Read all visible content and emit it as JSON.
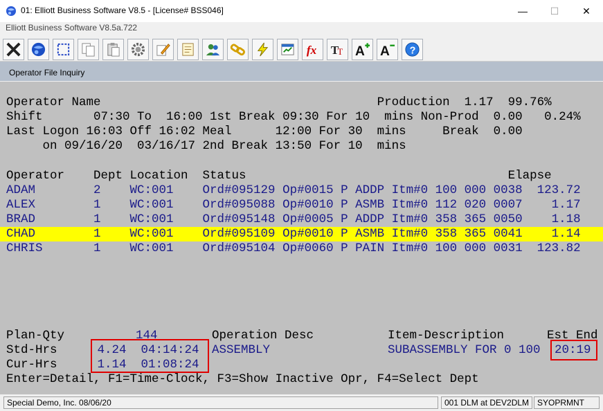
{
  "window": {
    "title": "01: Elliott Business Software V8.5 - [License# BSS046]",
    "subtitle": "Elliott Business Software V8.5a.722",
    "controls": {
      "minimize": "—",
      "maximize": "☐",
      "close": "✕"
    }
  },
  "toolbar": {
    "buttons": [
      {
        "icon": "close-x-icon"
      },
      {
        "icon": "globe-icon"
      },
      {
        "icon": "select-box-icon"
      },
      {
        "icon": "copy-icon"
      },
      {
        "icon": "paste-icon"
      },
      {
        "icon": "gear-icon"
      },
      {
        "icon": "edit-pencil-icon"
      },
      {
        "icon": "notepad-icon"
      },
      {
        "icon": "users-icon"
      },
      {
        "icon": "chain-link-icon"
      },
      {
        "icon": "lightning-icon"
      },
      {
        "icon": "report-icon"
      },
      {
        "icon": "function-fx-icon"
      },
      {
        "icon": "font-tt-icon"
      },
      {
        "icon": "font-increase-icon"
      },
      {
        "icon": "font-decrease-icon"
      },
      {
        "icon": "help-icon"
      }
    ]
  },
  "panel": {
    "title": "Operator File Inquiry"
  },
  "header": {
    "line1": "Operator Name                                      Production  1.17  99.76%",
    "line2": "Shift       07:30 To  16:00 1st Break 09:30 For 10  mins Non-Prod  0.00   0.24%",
    "line3": "Last Logon 16:03 Off 16:02 Meal      12:00 For 30  mins     Break  0.00",
    "line4": "     on 09/16/20  03/16/17 2nd Break 13:50 For 10  mins"
  },
  "table": {
    "header": "Operator    Dept Location  Status                                    Elapse",
    "rows": [
      "ADAM        2    WC:001    Ord#095129 Op#0015 P ADDP Itm#0 100 000 0038  123.72",
      "ALEX        1    WC:001    Ord#095088 Op#0010 P ASMB Itm#0 112 020 0007    1.17",
      "BRAD        1    WC:001    Ord#095148 Op#0005 P ADDP Itm#0 358 365 0050    1.18",
      "CHAD        1    WC:001    Ord#095109 Op#0010 P ASMB Itm#0 358 365 0041    1.14",
      "CHRIS       1    WC:001    Ord#095104 Op#0060 P PAIN Itm#0 100 000 0031  123.82"
    ],
    "highlight_color": "#ffff00"
  },
  "detail": {
    "plan_label": "Plan-Qty",
    "plan_value": "144",
    "op_desc_label": "Operation Desc",
    "item_desc_label": "Item-Description",
    "est_end_label": "Est End",
    "std_label": "Std-Hrs",
    "std_value": " 4.24  04:14:24",
    "op_desc_value": "ASSEMBLY",
    "item_desc_value": "SUBASSEMBLY FOR 0 100",
    "est_end_value": "20:19",
    "cur_label": "Cur-Hrs",
    "cur_value": " 1.14  01:08:24"
  },
  "keys": "Enter=Detail, F1=Time-Clock, F3=Show Inactive Opr, F4=Select Dept",
  "statusbar": {
    "company": "Special Demo, Inc. 08/06/20",
    "user": "001 DLM at DEV2DLM",
    "program": "SYOPRMNT"
  },
  "colors": {
    "terminal_bg": "#c0c0c0",
    "text_blue": "#1a1a8a",
    "annotation_red": "#e00000"
  }
}
